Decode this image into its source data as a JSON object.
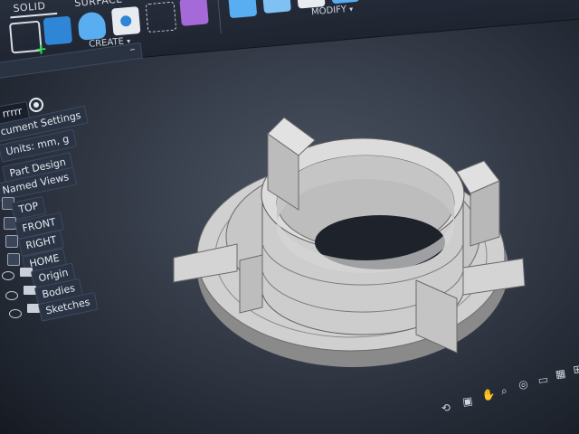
{
  "toolbar": {
    "tabs": [
      {
        "label": "SOLID"
      },
      {
        "label": "SURFACE"
      }
    ],
    "groups": {
      "create": {
        "label": "CREATE",
        "caret": "▾"
      },
      "modify": {
        "label": "MODIFY",
        "caret": "▾"
      }
    },
    "icons": [
      "create-sketch-icon",
      "box-icon",
      "sweep-icon",
      "hole-icon",
      "pattern-icon",
      "form-icon",
      "press-pull-icon",
      "fillet-icon",
      "chamfer-icon",
      "shell-icon"
    ]
  },
  "browser": {
    "root_name": "rrrrr",
    "items": [
      {
        "label": "cument Settings"
      },
      {
        "label": "Units: mm, g"
      },
      {
        "label": "Part Design"
      },
      {
        "label": "Named Views"
      },
      {
        "label": "TOP"
      },
      {
        "label": "FRONT"
      },
      {
        "label": "RIGHT"
      },
      {
        "label": "HOME"
      },
      {
        "label": "Origin"
      },
      {
        "label": "Bodies"
      },
      {
        "label": "Sketches"
      }
    ]
  },
  "navbar": {
    "icons": [
      "orbit-icon",
      "look-at-icon",
      "pan-icon",
      "zoom-icon",
      "fit-icon",
      "display-settings-icon",
      "grid-icon",
      "viewports-icon"
    ]
  },
  "colors": {
    "model_face": "#d9d9d9",
    "model_shadow": "#a9a9a9",
    "toolbar_bg": "#2b3240",
    "viewport_center": "#4a5260"
  }
}
